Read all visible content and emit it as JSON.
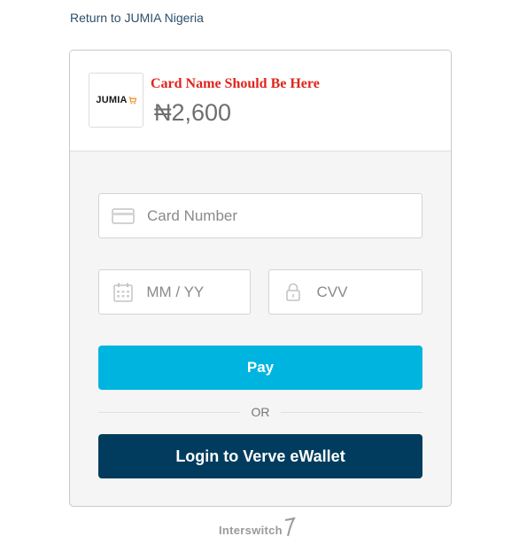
{
  "return_link": "Return to JUMIA Nigeria",
  "merchant": {
    "logo_text": "JUMIA",
    "card_name": "Card Name Should Be Here",
    "amount": "₦2,600"
  },
  "form": {
    "card_number_placeholder": "Card Number",
    "expiry_placeholder": "MM / YY",
    "cvv_placeholder": "CVV",
    "pay_label": "Pay",
    "or_label": "OR",
    "verve_label": "Login to Verve eWallet"
  },
  "footer": {
    "brand": "Interswitch"
  },
  "colors": {
    "pay": "#00b4e0",
    "verve": "#013c5e",
    "card_name": "#e0241b",
    "logo_accent": "#f68b1e"
  },
  "icons": [
    "credit-card-icon",
    "calendar-icon",
    "lock-icon",
    "cart-icon",
    "interswitch-swoosh-icon"
  ]
}
